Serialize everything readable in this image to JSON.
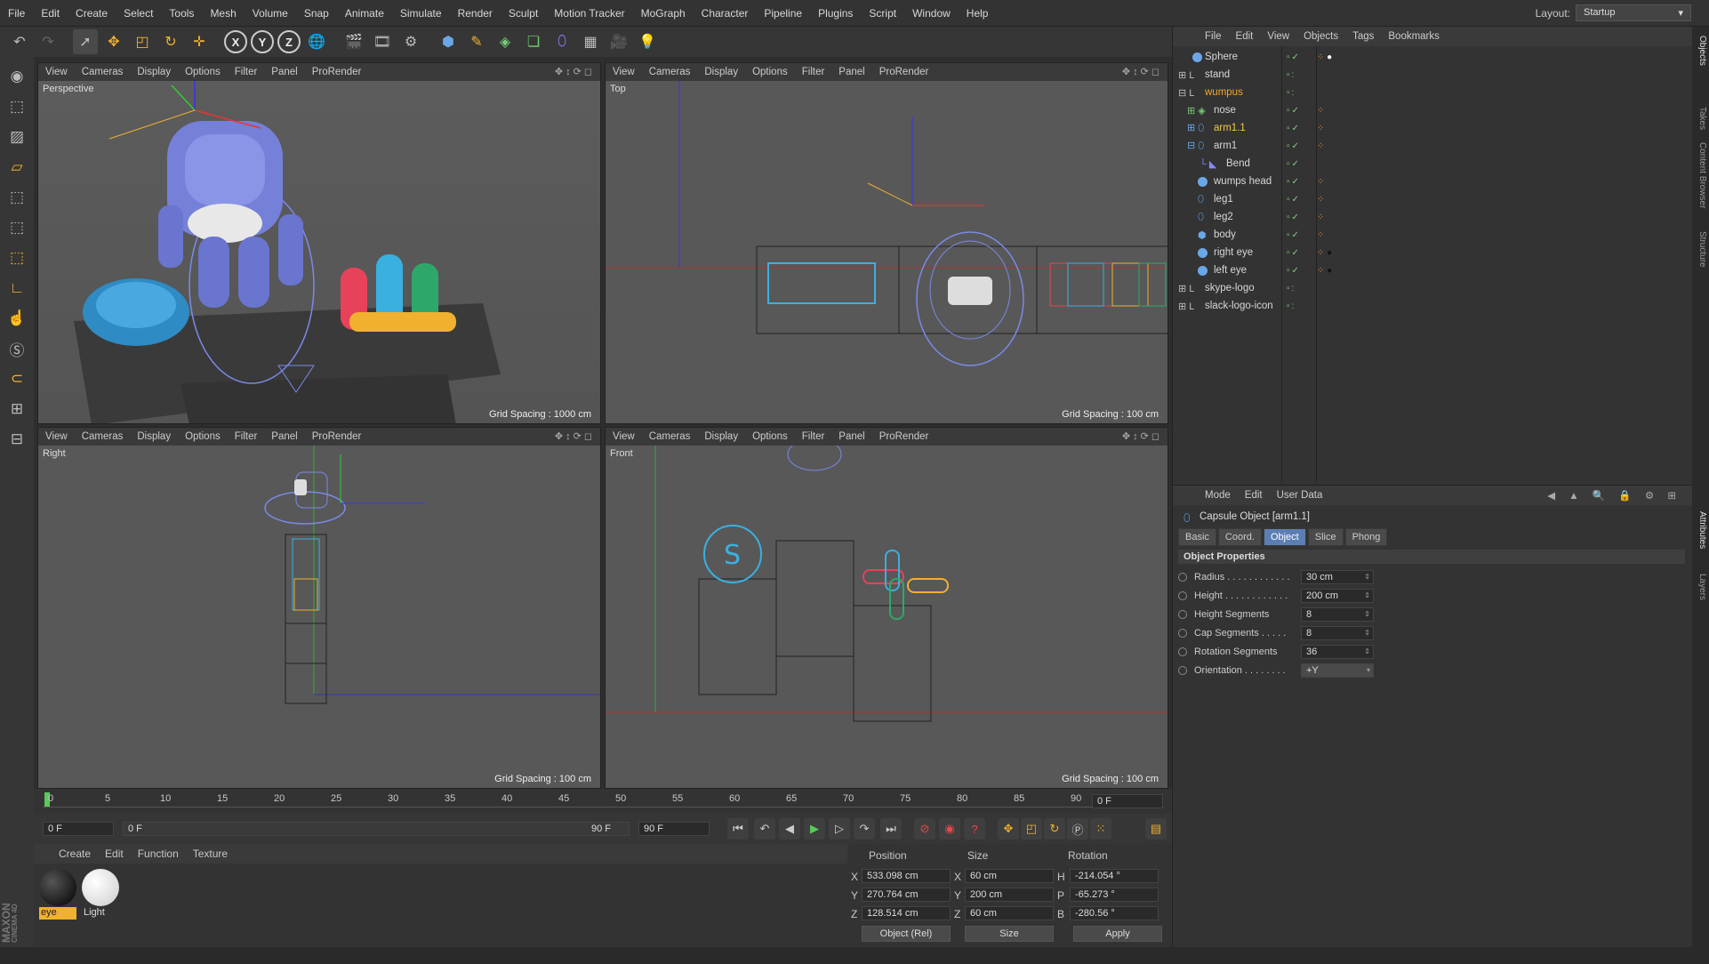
{
  "menu": [
    "File",
    "Edit",
    "Create",
    "Select",
    "Tools",
    "Mesh",
    "Volume",
    "Snap",
    "Animate",
    "Simulate",
    "Render",
    "Sculpt",
    "Motion Tracker",
    "MoGraph",
    "Character",
    "Pipeline",
    "Plugins",
    "Script",
    "Window",
    "Help"
  ],
  "layout": {
    "label": "Layout:",
    "value": "Startup"
  },
  "viewport_menu": [
    "View",
    "Cameras",
    "Display",
    "Options",
    "Filter",
    "Panel",
    "ProRender"
  ],
  "viewports": [
    {
      "name": "Perspective",
      "grid": "Grid Spacing : 1000 cm"
    },
    {
      "name": "Top",
      "grid": "Grid Spacing : 100 cm"
    },
    {
      "name": "Right",
      "grid": "Grid Spacing : 100 cm"
    },
    {
      "name": "Front",
      "grid": "Grid Spacing : 100 cm"
    }
  ],
  "object_manager": {
    "menu": [
      "File",
      "Edit",
      "View",
      "Objects",
      "Tags",
      "Bookmarks"
    ],
    "objects": [
      "Sphere",
      "stand",
      "wumpus",
      "nose",
      "arm1.1",
      "arm1",
      "Bend",
      "wumps head",
      "leg1",
      "leg2",
      "body",
      "right eye",
      "left eye",
      "skype-logo",
      "slack-logo-icon"
    ]
  },
  "side_tabs": [
    "Objects",
    "Takes",
    "Content Browser",
    "Structure",
    "Attributes",
    "Layers"
  ],
  "attributes": {
    "menu": [
      "Mode",
      "Edit",
      "User Data"
    ],
    "title": "Capsule Object [arm1.1]",
    "tabs": [
      "Basic",
      "Coord.",
      "Object",
      "Slice",
      "Phong"
    ],
    "section": "Object Properties",
    "props": [
      {
        "label": "Radius . . . . . . . . . . . .",
        "value": "30 cm"
      },
      {
        "label": "Height . . . . . . . . . . . .",
        "value": "200 cm"
      },
      {
        "label": "Height Segments",
        "value": "8"
      },
      {
        "label": "Cap Segments . . . . .",
        "value": "8"
      },
      {
        "label": "Rotation Segments",
        "value": "36"
      },
      {
        "label": "Orientation . . . . . . . .",
        "value": "+Y"
      }
    ]
  },
  "timeline": {
    "ticks": [
      "0",
      "5",
      "10",
      "15",
      "20",
      "25",
      "30",
      "35",
      "40",
      "45",
      "50",
      "55",
      "60",
      "65",
      "70",
      "75",
      "80",
      "85",
      "90"
    ],
    "current": "0 F",
    "start": "0 F",
    "range_start": "0 F",
    "range_end": "90 F",
    "end": "90 F"
  },
  "materials": {
    "menu": [
      "Create",
      "Edit",
      "Function",
      "Texture"
    ],
    "items": [
      "eye",
      "Light"
    ]
  },
  "coordinates": {
    "headers": [
      "Position",
      "Size",
      "Rotation"
    ],
    "rows": [
      {
        "axis": "X",
        "pos": "533.098 cm",
        "saxis": "X",
        "size": "60 cm",
        "raxis": "H",
        "rot": "-214.054 °"
      },
      {
        "axis": "Y",
        "pos": "270.764 cm",
        "saxis": "Y",
        "size": "200 cm",
        "raxis": "P",
        "rot": "-65.273 °"
      },
      {
        "axis": "Z",
        "pos": "128.514 cm",
        "saxis": "Z",
        "size": "60 cm",
        "raxis": "B",
        "rot": "-280.56 °"
      }
    ],
    "mode": "Object (Rel)",
    "size_mode": "Size",
    "apply": "Apply"
  },
  "brand": {
    "line1": "MAXON",
    "line2": "CINEMA 4D"
  }
}
